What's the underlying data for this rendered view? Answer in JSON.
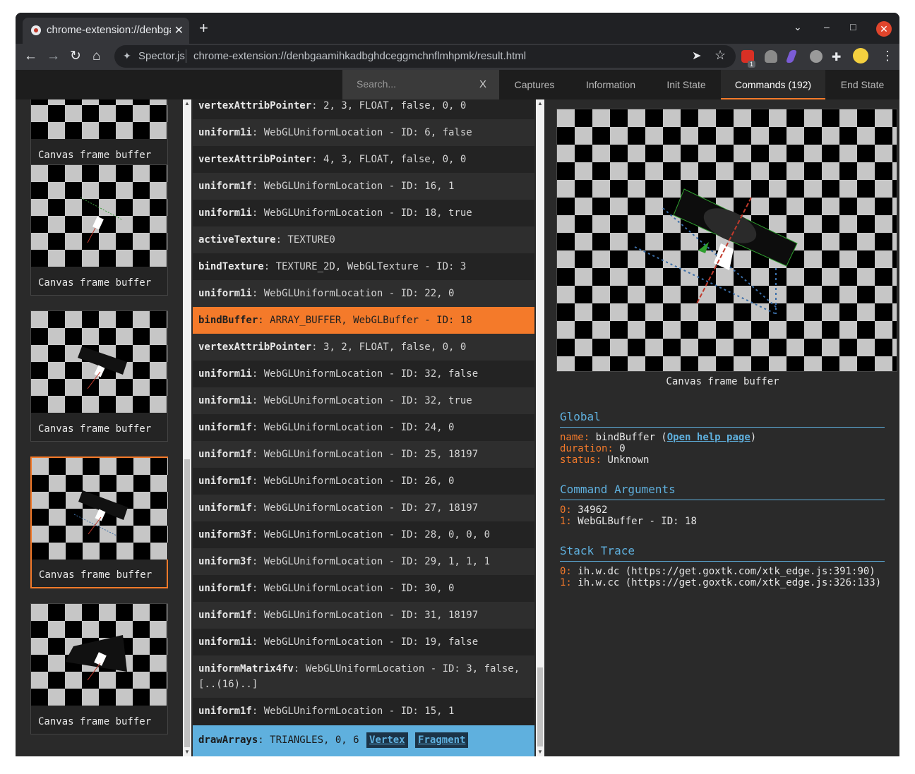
{
  "browser": {
    "tab_title": "chrome-extension://denbgaamihkadbghdceggmchnflmhpmk/result.html",
    "tab_close": "✕",
    "new_tab": "+",
    "site_name": "Spector.js",
    "url": "chrome-extension://denbgaamihkadbghdceggmchnflmhpmk/result.html",
    "extension_badge": "1",
    "window_controls": {
      "dropdown": "⌄",
      "minimize": "–",
      "maximize": "□",
      "close": "✕"
    },
    "nav": {
      "back": "←",
      "forward": "→",
      "reload": "↻",
      "home": "⌂"
    }
  },
  "spector": {
    "search_placeholder": "Search...",
    "search_clear": "X",
    "tabs": [
      {
        "label": "Captures"
      },
      {
        "label": "Information"
      },
      {
        "label": "Init State"
      },
      {
        "label": "Commands (192)"
      },
      {
        "label": "End State"
      }
    ],
    "active_tab": "Commands (192)",
    "thumbnails": [
      {
        "label": "Canvas frame buffer"
      },
      {
        "label": "Canvas frame buffer"
      },
      {
        "label": "Canvas frame buffer"
      },
      {
        "label": "Canvas frame buffer"
      },
      {
        "label": "Canvas frame buffer"
      }
    ],
    "commands": [
      {
        "name": "vertexAttribPointer",
        "args": ": 2, 3, FLOAT, false, 0, 0"
      },
      {
        "name": "uniform1i",
        "args": ": WebGLUniformLocation - ID: 6, false"
      },
      {
        "name": "vertexAttribPointer",
        "args": ": 4, 3, FLOAT, false, 0, 0"
      },
      {
        "name": "uniform1f",
        "args": ": WebGLUniformLocation - ID: 16, 1"
      },
      {
        "name": "uniform1i",
        "args": ": WebGLUniformLocation - ID: 18, true"
      },
      {
        "name": "activeTexture",
        "args": ": TEXTURE0"
      },
      {
        "name": "bindTexture",
        "args": ": TEXTURE_2D, WebGLTexture - ID: 3"
      },
      {
        "name": "uniform1i",
        "args": ": WebGLUniformLocation - ID: 22, 0"
      },
      {
        "name": "bindBuffer",
        "args": ": ARRAY_BUFFER, WebGLBuffer - ID: 18"
      },
      {
        "name": "vertexAttribPointer",
        "args": ": 3, 2, FLOAT, false, 0, 0"
      },
      {
        "name": "uniform1i",
        "args": ": WebGLUniformLocation - ID: 32, false"
      },
      {
        "name": "uniform1i",
        "args": ": WebGLUniformLocation - ID: 32, true"
      },
      {
        "name": "uniform1f",
        "args": ": WebGLUniformLocation - ID: 24, 0"
      },
      {
        "name": "uniform1f",
        "args": ": WebGLUniformLocation - ID: 25, 18197"
      },
      {
        "name": "uniform1f",
        "args": ": WebGLUniformLocation - ID: 26, 0"
      },
      {
        "name": "uniform1f",
        "args": ": WebGLUniformLocation - ID: 27, 18197"
      },
      {
        "name": "uniform3f",
        "args": ": WebGLUniformLocation - ID: 28, 0, 0, 0"
      },
      {
        "name": "uniform3f",
        "args": ": WebGLUniformLocation - ID: 29, 1, 1, 1"
      },
      {
        "name": "uniform1f",
        "args": ": WebGLUniformLocation - ID: 30, 0"
      },
      {
        "name": "uniform1f",
        "args": ": WebGLUniformLocation - ID: 31, 18197"
      },
      {
        "name": "uniform1i",
        "args": ": WebGLUniformLocation - ID: 19, false"
      },
      {
        "name": "uniformMatrix4fv",
        "args": ": WebGLUniformLocation - ID: 3, false, [..(16)..]"
      },
      {
        "name": "uniform1f",
        "args": ": WebGLUniformLocation - ID: 15, 1"
      }
    ],
    "selected_command": "bindBuffer",
    "draw_command": {
      "name": "drawArrays",
      "args": ": TRIANGLES, 0, 6",
      "vertex_link": "Vertex",
      "fragment_link": "Fragment"
    },
    "preview_label": "Canvas frame buffer",
    "global": {
      "title": "Global",
      "name_key": "name:",
      "name_value": "bindBuffer",
      "help_link": "Open help page",
      "duration_key": "duration:",
      "duration_value": "0",
      "status_key": "status:",
      "status_value": "Unknown"
    },
    "command_arguments": {
      "title": "Command Arguments",
      "items": [
        {
          "key": "0:",
          "value": "34962"
        },
        {
          "key": "1:",
          "value": "WebGLBuffer - ID: 18"
        }
      ]
    },
    "stack_trace": {
      "title": "Stack Trace",
      "items": [
        {
          "key": "0:",
          "value": "ih.w.dc (https://get.goxtk.com/xtk_edge.js:391:90)"
        },
        {
          "key": "1:",
          "value": "ih.w.cc (https://get.goxtk.com/xtk_edge.js:326:133)"
        }
      ]
    }
  },
  "colors": {
    "accent_orange": "#f47a2a",
    "accent_blue": "#5fb0de",
    "panel_bg": "#2a2a2a"
  }
}
